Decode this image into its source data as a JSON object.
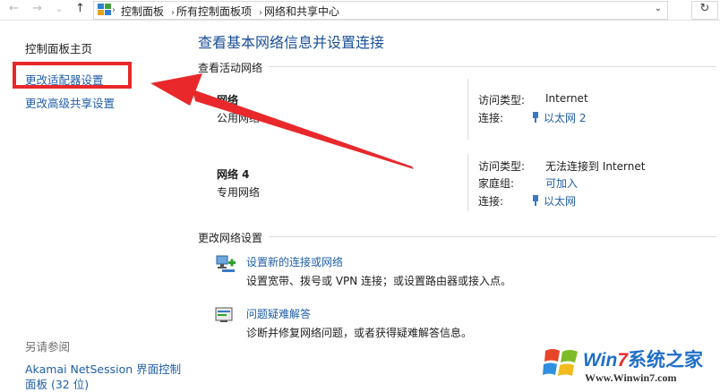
{
  "addressbar": {
    "back_icon": "←",
    "forward_icon": "→",
    "history_icon": "⌄",
    "up_icon": "↑",
    "crumbs": [
      "控制面板",
      "所有控制面板项",
      "网络和共享中心"
    ],
    "refresh_icon": "↻",
    "dropdown_icon": "⌄"
  },
  "sidebar": {
    "home": "控制面板主页",
    "adapter": "更改适配器设置",
    "sharing": "更改高级共享设置",
    "see_also": "另请参阅",
    "akamai_line1": "Akamai NetSession 界面控制",
    "akamai_line2": "面板 (32 位)"
  },
  "main": {
    "title": "查看基本网络信息并设置连接",
    "active_header": "查看活动网络",
    "net1": {
      "name": "网络",
      "type": "公用网络",
      "access_label": "访问类型:",
      "access_value": "Internet",
      "conn_label": "连接:",
      "conn_value": "以太网 2"
    },
    "net2": {
      "name": "网络  4",
      "type": "专用网络",
      "access_label": "访问类型:",
      "access_value": "无法连接到 Internet",
      "home_label": "家庭组:",
      "home_value": "可加入",
      "conn_label": "连接:",
      "conn_value": "以太网"
    },
    "change_header": "更改网络设置",
    "setup_link": "设置新的连接或网络",
    "setup_desc": "设置宽带、拨号或 VPN 连接；或设置路由器或接入点。",
    "trouble_link": "问题疑难解答",
    "trouble_desc": "诊断并修复网络问题，或者获得疑难解答信息。"
  },
  "watermark": {
    "brand_a": "Win",
    "brand_b": "7",
    "brand_c": "系统之家",
    "url": "Www.Winwin7.com"
  },
  "colors": {
    "link": "#1f5ea8",
    "title": "#1a4f97",
    "annotation": "#e8282b"
  }
}
